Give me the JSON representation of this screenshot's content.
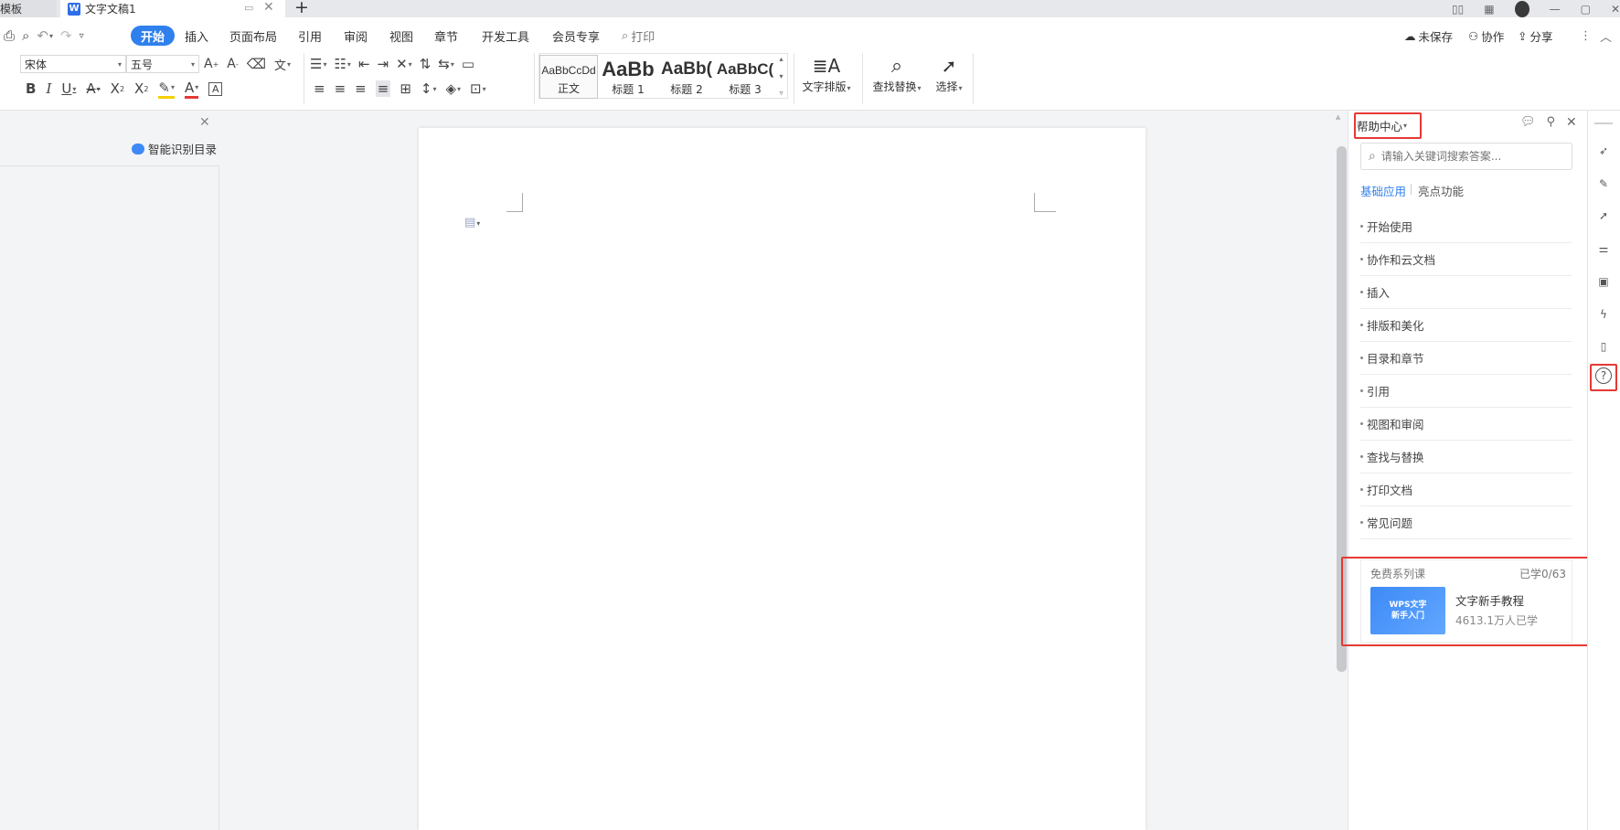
{
  "tabs": [
    {
      "label": "模板"
    },
    {
      "label": "文字文稿1"
    }
  ],
  "window": {
    "add_tab": "+"
  },
  "menu": {
    "start": "开始",
    "insert": "插入",
    "page_layout": "页面布局",
    "references": "引用",
    "review": "审阅",
    "view": "视图",
    "chapter": "章节",
    "developer": "开发工具",
    "member": "会员专享",
    "print": "打印"
  },
  "top_right": {
    "unsaved": "未保存",
    "collaborate": "协作",
    "share": "分享"
  },
  "font": {
    "family": "宋体",
    "size": "五号"
  },
  "styles": [
    {
      "preview": "AaBbCcDd",
      "label": "正文"
    },
    {
      "preview": "AaBb",
      "label": "标题 1"
    },
    {
      "preview": "AaBb(",
      "label": "标题 2"
    },
    {
      "preview": "AaBbC(",
      "label": "标题 3"
    }
  ],
  "buttons": {
    "text_layout": "文字排版",
    "find_replace": "查找替换",
    "select": "选择"
  },
  "left_panel": {
    "smart_toc": "智能识别目录"
  },
  "help": {
    "title": "帮助中心",
    "search_placeholder": "请输入关键词搜索答案...",
    "tab_basic": "基础应用",
    "tab_highlight": "亮点功能",
    "items": [
      {
        "label": "开始使用"
      },
      {
        "label": "协作和云文档"
      },
      {
        "label": "插入"
      },
      {
        "label": "排版和美化"
      },
      {
        "label": "目录和章节"
      },
      {
        "label": "引用"
      },
      {
        "label": "视图和审阅"
      },
      {
        "label": "查找与替换"
      },
      {
        "label": "打印文档"
      },
      {
        "label": "常见问题"
      }
    ],
    "course": {
      "section": "免费系列课",
      "progress": "已学0/63",
      "thumb_line1": "WPS文字",
      "thumb_line2": "新手入门",
      "title": "文字新手教程",
      "learners": "4613.1万人已学"
    }
  },
  "colors": {
    "accent": "#2f80ed",
    "highlight_border": "#e53935"
  }
}
